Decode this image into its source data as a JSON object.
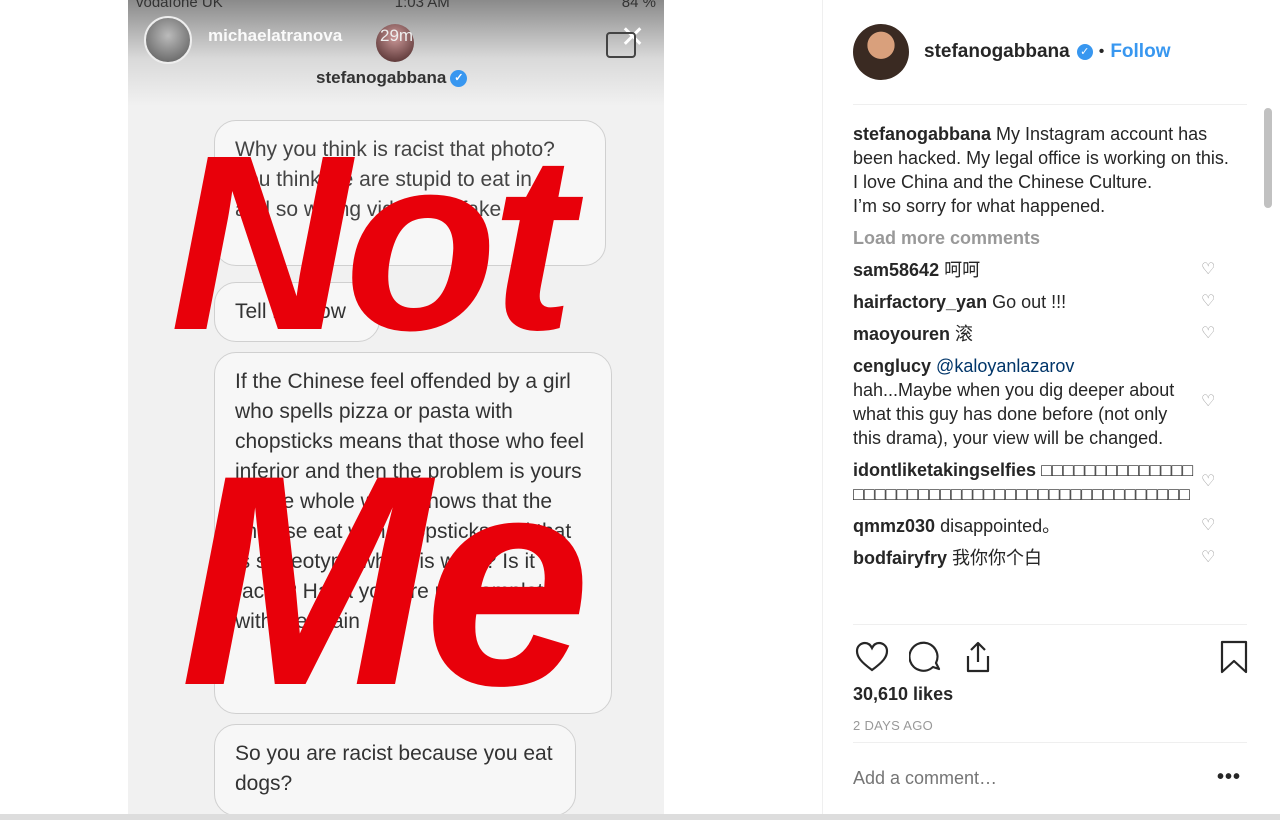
{
  "story": {
    "carrier": "vodafone UK",
    "time": "1:03 AM",
    "battery": "84 %",
    "story_user": "michaelatranova",
    "story_time": "29m",
    "chat_user": "stefanogabbana",
    "bubbles": [
      "Why you think is racist that photo? You think we are stupid to eat in a and so wrong video is a fake",
      "Tell me how",
      "If the Chinese feel offended by a girl who spells pizza or pasta with chopsticks means that those who feel inferior and then the problem is yours !!! The whole world knows that the chinese eat with chopsticks and that is stereotype which is what? Is it racist? Haha you are not complete with the brain",
      "So you are racist because you eat dogs?"
    ],
    "overlay_top": "Not",
    "overlay_bottom": "Me"
  },
  "post": {
    "username": "stefanogabbana",
    "follow_label": "Follow",
    "dot": "•",
    "caption_user": "stefanogabbana",
    "caption_lines": [
      "My Instagram account has been hacked. My legal office is working on this.",
      "I love China and the Chinese Culture.",
      "I’m so sorry for what happened."
    ],
    "load_more": "Load more comments",
    "comments": [
      {
        "user": "sam58642",
        "mention": "",
        "text": "呵呵"
      },
      {
        "user": "hairfactory_yan",
        "mention": "",
        "text": "Go out !!!"
      },
      {
        "user": "maoyouren",
        "mention": "",
        "text": "滚"
      },
      {
        "user": "cenglucy",
        "mention": "@kaloyanlazarov",
        "text": "hah...Maybe when you dig deeper about what this guy has done before (not only this drama), your view will be changed."
      },
      {
        "user": "idontliketakingselfies",
        "mention": "",
        "text": "□□□□□□□□□□□□□□□□□□□□□□□□□□□□□□□□□□□□□□□□□□□□□"
      },
      {
        "user": "qmmz030",
        "mention": "",
        "text": "disappointed。"
      },
      {
        "user": "bodfairyfry",
        "mention": "",
        "text": "我你你个白"
      }
    ],
    "likes": "30,610 likes",
    "posted": "2 DAYS AGO",
    "add_comment_placeholder": "Add a comment…",
    "more": "•••"
  },
  "colors": {
    "accent": "#3897f0",
    "overlay_red": "#e8000a"
  }
}
